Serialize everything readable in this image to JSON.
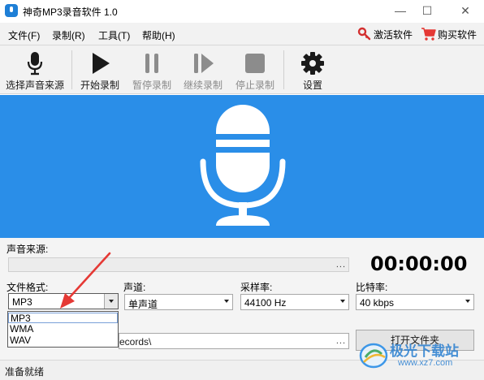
{
  "window": {
    "title": "神奇MP3录音软件 1.0",
    "minimize": "—",
    "maximize": "☐",
    "close": "✕"
  },
  "menu": {
    "items": [
      "文件(F)",
      "录制(R)",
      "工具(T)",
      "帮助(H)"
    ],
    "activate_label": "激活软件",
    "buy_label": "购买软件"
  },
  "toolbar": {
    "select_source": "选择声音来源",
    "start": "开始录制",
    "pause": "暂停录制",
    "resume": "继续录制",
    "stop": "停止录制",
    "settings": "设置"
  },
  "form": {
    "source_label": "声音来源:",
    "source_browse": "...",
    "timer": "00:00:00",
    "format_label": "文件格式:",
    "format_value": "MP3",
    "format_options": [
      "MP3",
      "WMA",
      "WAV"
    ],
    "channel_label": "声道:",
    "channel_value": "单声道",
    "samplerate_label": "采样率:",
    "samplerate_value": "44100 Hz",
    "bitrate_label": "比特率:",
    "bitrate_value": "40 kbps",
    "path_value": "ecords\\",
    "path_browse": "...",
    "open_folder": "打开文件夹"
  },
  "status": {
    "text": "准备就绪"
  },
  "watermark": {
    "text": "极光下载站",
    "url": "www.xz7.com"
  },
  "colors": {
    "banner": "#2a8ee8",
    "accent_red": "#e53935",
    "key_red": "#d32f2f"
  }
}
